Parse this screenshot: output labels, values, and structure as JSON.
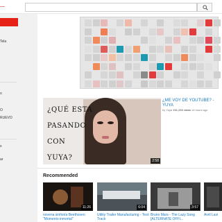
{
  "header": {
    "search_placeholder": "",
    "search_icon": "search-icon"
  },
  "guide": {
    "items": [
      "Tela",
      "o",
      "O",
      "RUEVO",
      "s",
      "ar"
    ]
  },
  "banner": {
    "tiles": [
      {
        "col": 0,
        "row": 0,
        "color": "#d9d9d9"
      },
      {
        "col": 1,
        "row": 0,
        "color": "#d0d0d0"
      },
      {
        "col": 2,
        "row": 0,
        "color": "#e7b9b9"
      },
      {
        "col": 4,
        "row": 0,
        "color": "#d6d6d6"
      },
      {
        "col": 5,
        "row": 0,
        "color": "#f0b8a8"
      },
      {
        "col": 7,
        "row": 0,
        "color": "#d5d5d5"
      },
      {
        "col": 9,
        "row": 0,
        "color": "#cfcfcf"
      },
      {
        "col": 11,
        "row": 0,
        "color": "#dcdcdc"
      },
      {
        "col": 12,
        "row": 0,
        "color": "#d8d8d8"
      },
      {
        "col": 14,
        "row": 0,
        "color": "#e0d0d0"
      },
      {
        "col": 15,
        "row": 0,
        "color": "#e33b3b"
      },
      {
        "col": 16,
        "row": 0,
        "color": "#cfcfcf"
      },
      {
        "col": 0,
        "row": 1,
        "color": "#cfcfcf"
      },
      {
        "col": 2,
        "row": 1,
        "color": "#f07e52"
      },
      {
        "col": 3,
        "row": 1,
        "color": "#ddd"
      },
      {
        "col": 5,
        "row": 1,
        "color": "#cccccc"
      },
      {
        "col": 6,
        "row": 1,
        "color": "#d1d1d1"
      },
      {
        "col": 8,
        "row": 1,
        "color": "#d9d9d9"
      },
      {
        "col": 9,
        "row": 1,
        "color": "#e5c7c7"
      },
      {
        "col": 11,
        "row": 1,
        "color": "#d4d4d4"
      },
      {
        "col": 12,
        "row": 1,
        "color": "#f0c0b0"
      },
      {
        "col": 13,
        "row": 1,
        "color": "#e33b3b"
      },
      {
        "col": 15,
        "row": 1,
        "color": "#d3d3d3"
      },
      {
        "col": 0,
        "row": 2,
        "color": "#d2d2d2"
      },
      {
        "col": 1,
        "row": 2,
        "color": "#f08a5a"
      },
      {
        "col": 2,
        "row": 2,
        "color": "#d0d0d0"
      },
      {
        "col": 3,
        "row": 2,
        "color": "#e0b0b0"
      },
      {
        "col": 5,
        "row": 2,
        "color": "#e5e5e5"
      },
      {
        "col": 7,
        "row": 2,
        "color": "#d0d0d0"
      },
      {
        "col": 8,
        "row": 2,
        "color": "#e0e0e0"
      },
      {
        "col": 10,
        "row": 2,
        "color": "#d2d2d2"
      },
      {
        "col": 11,
        "row": 2,
        "color": "#e8c0c0"
      },
      {
        "col": 13,
        "row": 2,
        "color": "#d6d6d6"
      },
      {
        "col": 14,
        "row": 2,
        "color": "#cfcfcf"
      },
      {
        "col": 15,
        "row": 2,
        "color": "#e04a5a"
      },
      {
        "col": 16,
        "row": 2,
        "color": "#d3d3d3"
      },
      {
        "col": 0,
        "row": 3,
        "color": "#e0e0e0"
      },
      {
        "col": 1,
        "row": 3,
        "color": "#d5d5d5"
      },
      {
        "col": 2,
        "row": 3,
        "color": "#e05a5a"
      },
      {
        "col": 3,
        "row": 3,
        "color": "#d0d0d0"
      },
      {
        "col": 4,
        "row": 3,
        "color": "#1e9ab0"
      },
      {
        "col": 5,
        "row": 3,
        "color": "#d8d8d8"
      },
      {
        "col": 6,
        "row": 3,
        "color": "#f0a070"
      },
      {
        "col": 8,
        "row": 3,
        "color": "#d2d2d2"
      },
      {
        "col": 9,
        "row": 3,
        "color": "#d7d7d7"
      },
      {
        "col": 10,
        "row": 3,
        "color": "#e8c0b8"
      },
      {
        "col": 12,
        "row": 3,
        "color": "#d0d0d0"
      },
      {
        "col": 13,
        "row": 3,
        "color": "#d6d6d6"
      },
      {
        "col": 15,
        "row": 3,
        "color": "#e33b3b"
      },
      {
        "col": 16,
        "row": 3,
        "color": "#d9d9d9"
      },
      {
        "col": 0,
        "row": 4,
        "color": "#d4d4d4"
      },
      {
        "col": 1,
        "row": 4,
        "color": "#cfcfcf"
      },
      {
        "col": 2,
        "row": 4,
        "color": "#e8c8c8"
      },
      {
        "col": 3,
        "row": 4,
        "color": "#f0c0a0"
      },
      {
        "col": 4,
        "row": 4,
        "color": "#d6d6d6"
      },
      {
        "col": 5,
        "row": 4,
        "color": "#d0d0d0"
      },
      {
        "col": 6,
        "row": 4,
        "color": "#d8d8d8"
      },
      {
        "col": 7,
        "row": 4,
        "color": "#1e9ab0"
      },
      {
        "col": 8,
        "row": 4,
        "color": "#d5d5d5"
      },
      {
        "col": 10,
        "row": 4,
        "color": "#d7d7d7"
      },
      {
        "col": 11,
        "row": 4,
        "color": "#d0d0d0"
      },
      {
        "col": 12,
        "row": 4,
        "color": "#f08a5a"
      },
      {
        "col": 13,
        "row": 4,
        "color": "#d3d3d3"
      },
      {
        "col": 14,
        "row": 4,
        "color": "#e0e0e0"
      },
      {
        "col": 16,
        "row": 4,
        "color": "#d2d2d2"
      },
      {
        "col": 1,
        "row": 5,
        "color": "#f08a5a"
      },
      {
        "col": 2,
        "row": 5,
        "color": "#d5d5d5"
      },
      {
        "col": 3,
        "row": 5,
        "color": "#e0c0c0"
      },
      {
        "col": 5,
        "row": 5,
        "color": "#d0d0d0"
      },
      {
        "col": 6,
        "row": 5,
        "color": "#d8d8d8"
      },
      {
        "col": 8,
        "row": 5,
        "color": "#d4d4d4"
      },
      {
        "col": 9,
        "row": 5,
        "color": "#1e9ab0"
      },
      {
        "col": 10,
        "row": 5,
        "color": "#e33b3b"
      },
      {
        "col": 12,
        "row": 5,
        "color": "#d6d6d6"
      },
      {
        "col": 13,
        "row": 5,
        "color": "#d0d0d0"
      },
      {
        "col": 14,
        "row": 5,
        "color": "#d8d8d8"
      },
      {
        "col": 15,
        "row": 5,
        "color": "#e0e0e0"
      },
      {
        "col": 0,
        "row": 6,
        "color": "#d0d0d0"
      },
      {
        "col": 2,
        "row": 6,
        "color": "#d6d6d6"
      },
      {
        "col": 3,
        "row": 6,
        "color": "#d3d3d3"
      },
      {
        "col": 4,
        "row": 6,
        "color": "#e0c0c0"
      },
      {
        "col": 6,
        "row": 6,
        "color": "#d4d4d4"
      },
      {
        "col": 7,
        "row": 6,
        "color": "#8a8a8a"
      },
      {
        "col": 8,
        "row": 6,
        "color": "#e33b3b"
      },
      {
        "col": 9,
        "row": 6,
        "color": "#d2d2d2"
      },
      {
        "col": 11,
        "row": 6,
        "color": "#d0d0d0"
      },
      {
        "col": 12,
        "row": 6,
        "color": "#d8d8d8"
      },
      {
        "col": 14,
        "row": 6,
        "color": "#d5d5d5"
      },
      {
        "col": 16,
        "row": 6,
        "color": "#d0d0d0"
      },
      {
        "col": 0,
        "row": 7,
        "color": "#dadada"
      },
      {
        "col": 1,
        "row": 7,
        "color": "#e8c0c0"
      },
      {
        "col": 2,
        "row": 7,
        "color": "#d3d3d3"
      },
      {
        "col": 3,
        "row": 7,
        "color": "#d0d0d0"
      },
      {
        "col": 4,
        "row": 7,
        "color": "#e0c8c8"
      },
      {
        "col": 5,
        "row": 7,
        "color": "#d5d5d5"
      },
      {
        "col": 7,
        "row": 7,
        "color": "#c9c9c9"
      },
      {
        "col": 8,
        "row": 7,
        "color": "#d8d8d8"
      },
      {
        "col": 9,
        "row": 7,
        "color": "#d0d0d0"
      },
      {
        "col": 10,
        "row": 7,
        "color": "#d3d3d3"
      },
      {
        "col": 12,
        "row": 7,
        "color": "#d6d6d6"
      },
      {
        "col": 13,
        "row": 7,
        "color": "#e0e0e0"
      },
      {
        "col": 14,
        "row": 7,
        "color": "#d2d2d2"
      },
      {
        "col": 15,
        "row": 7,
        "color": "#d5d5d5"
      }
    ]
  },
  "featured": {
    "thumb_text": "¿QUÉ ESTA PASANDO CON YUYA?",
    "duration": "2:58",
    "title": "¿ME VOY DE YOUTUBE? - YUYA",
    "by": "by Yuya",
    "views": "151,226 views",
    "age": "14 hours ago"
  },
  "recommended": {
    "heading": "Recommended",
    "items": [
      {
        "title": "novena sinfonía Beethoven \"Momento inmortal\"",
        "duration": "11:26"
      },
      {
        "title": "Utility Trailer Manufacturing - Test Track",
        "duration": "6:04"
      },
      {
        "title": "Bruno Mars - The Lazy Song [ALTERNATE OFFI...",
        "duration": "3:57"
      },
      {
        "title": "Avril Lavi",
        "duration": ""
      }
    ]
  }
}
